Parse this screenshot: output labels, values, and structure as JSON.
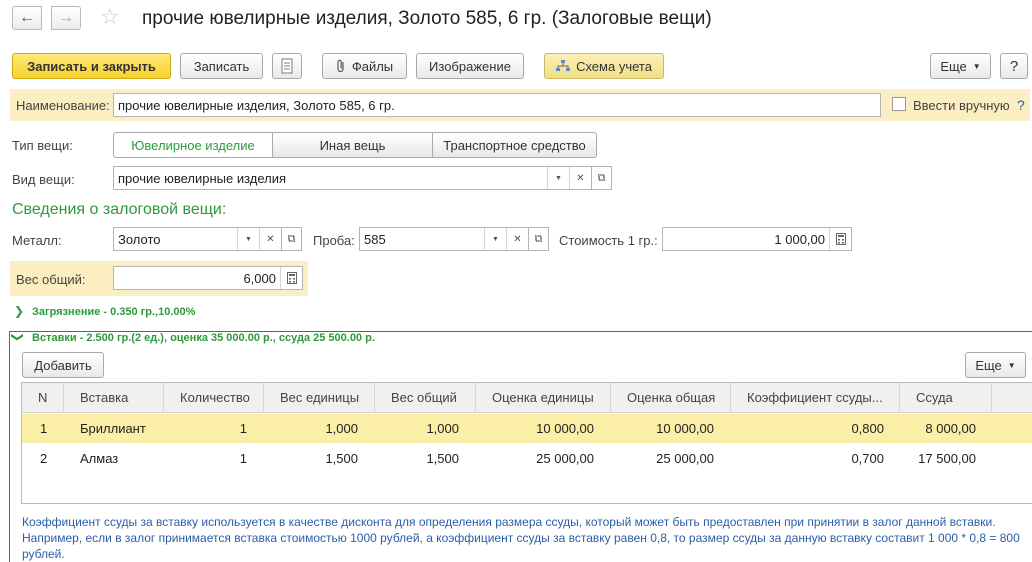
{
  "window": {
    "title": "прочие ювелирные изделия, Золото 585, 6 гр. (Залоговые вещи)"
  },
  "toolbar": {
    "save_close": "Записать и закрыть",
    "save": "Записать",
    "files": "Файлы",
    "image": "Изображение",
    "scheme": "Схема учета",
    "more": "Еще"
  },
  "form": {
    "name_label": "Наименование:",
    "name_value": "прочие ювелирные изделия, Золото 585, 6 гр.",
    "manual_label": "Ввести вручную",
    "help": "?",
    "type_label": "Тип вещи:",
    "type_options": [
      "Ювелирное изделие",
      "Иная вещь",
      "Транспортное средство"
    ],
    "kind_label": "Вид вещи:",
    "kind_value": "прочие ювелирные изделия",
    "section_title": "Сведения о залоговой вещи:",
    "metal_label": "Металл:",
    "metal_value": "Золото",
    "probe_label": "Проба:",
    "probe_value": "585",
    "cost_label": "Стоимость 1 гр.:",
    "cost_value": "1 000,00",
    "weight_label": "Вес общий:",
    "weight_value": "6,000"
  },
  "groups": {
    "pollution": "Загрязнение - 0.350 гр.,10.00%",
    "inserts": "Вставки - 2.500 гр.(2 ед.), оценка 35 000.00 р., ссуда 25 500.00 р."
  },
  "inserts_toolbar": {
    "add": "Добавить",
    "more": "Еще"
  },
  "table": {
    "headers": [
      "N",
      "Вставка",
      "Количество",
      "Вес единицы",
      "Вес общий",
      "Оценка единицы",
      "Оценка общая",
      "Коэффициент ссуды...",
      "Ссуда"
    ],
    "rows": [
      [
        "1",
        "Бриллиант",
        "1",
        "1,000",
        "1,000",
        "10 000,00",
        "10 000,00",
        "0,800",
        "8 000,00"
      ],
      [
        "2",
        "Алмаз",
        "1",
        "1,500",
        "1,500",
        "25 000,00",
        "25 000,00",
        "0,700",
        "17 500,00"
      ]
    ]
  },
  "hint": "Коэффициент ссуды за вставку используется в качестве дисконта для определения размера ссуды, который может быть предоставлен при принятии в залог данной вставки. Например, если в залог принимается вставка стоимостью 1000 рублей, а коэффициент ссуды за вставку равен 0,8, то размер ссуды за данную вставку составит 1 000 * 0,8 = 800 рублей."
}
